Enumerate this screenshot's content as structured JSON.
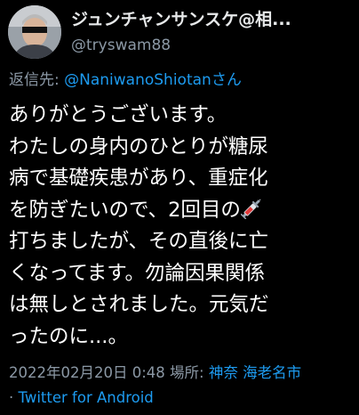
{
  "user": {
    "display_name": "ジュンチャンサンスケ@相...",
    "handle": "@tryswam88",
    "avatar_icon": "user-avatar-photo"
  },
  "reply": {
    "prefix": "返信先: ",
    "target": "@NaniwanoShiotan",
    "suffix": "さん"
  },
  "body": {
    "lines": [
      "ありがとうございます。",
      "わたしの身内のひとりが糖尿",
      "病で基礎疾患があり、重症化",
      "を防ぎたいので、2回目の",
      "打ちましたが、その直後に亡",
      "くなってます。勿論因果関係",
      "は無しとされました。元気だ",
      "ったのに...。"
    ],
    "emoji_icon": "syringe-icon"
  },
  "meta": {
    "date": "2022年02月20日 0:48",
    "place_label": " 場所: ",
    "place_value": "神奈 海老名市",
    "separator": "· ",
    "client": "Twitter for Android"
  },
  "colors": {
    "background": "#000000",
    "text": "#ffffff",
    "secondary": "#8b98a5",
    "link": "#1d9bf0"
  }
}
